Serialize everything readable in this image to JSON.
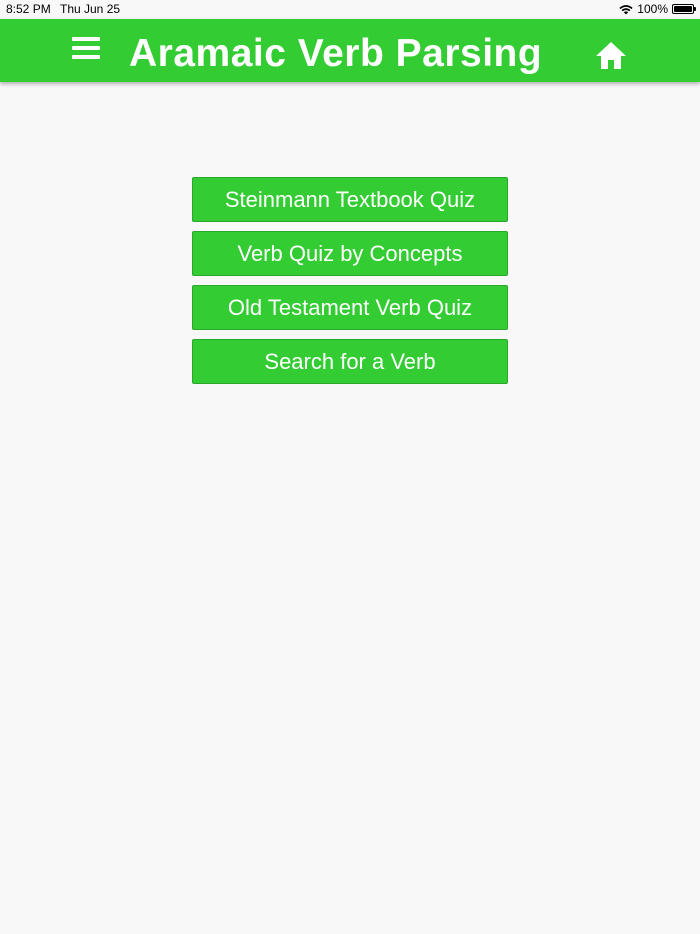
{
  "status_bar": {
    "time": "8:52 PM",
    "date": "Thu Jun 25",
    "battery_percent": "100%",
    "battery_level": 1.0,
    "wifi_icon": "wifi-icon",
    "battery_icon": "battery-icon"
  },
  "header": {
    "title": "Aramaic Verb Parsing",
    "menu_icon": "hamburger-menu-icon",
    "home_icon": "home-icon",
    "background_color": "#33cc33"
  },
  "menu": {
    "buttons": [
      {
        "label": "Steinmann Textbook Quiz"
      },
      {
        "label": "Verb Quiz by Concepts"
      },
      {
        "label": "Old Testament Verb Quiz"
      },
      {
        "label": "Search for a Verb"
      }
    ],
    "button_color": "#33cc33"
  }
}
